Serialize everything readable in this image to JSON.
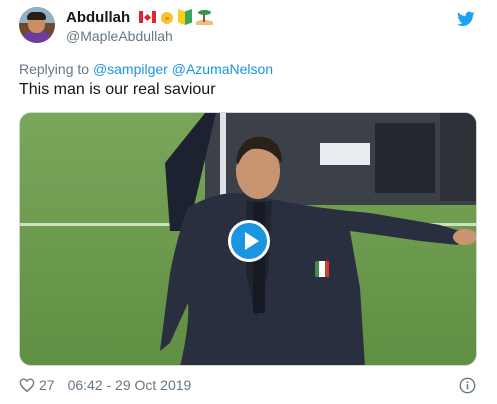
{
  "author": {
    "display_name": "Abdullah",
    "handle": "@MapleAbdullah",
    "name_emojis": [
      "canada-flag-icon",
      "baby-chick-icon",
      "japanese-beginner-symbol-icon",
      "desert-island-icon"
    ]
  },
  "reply": {
    "prefix": "Replying to",
    "mentions": [
      "@sampilger",
      "@AzumaNelson"
    ]
  },
  "tweet": {
    "text": "This man is our real saviour"
  },
  "media": {
    "type": "video",
    "play_icon": "play-icon"
  },
  "footer": {
    "likes": "27",
    "timestamp": "06:42 - 29 Oct 2019",
    "heart_icon": "heart-icon",
    "info_icon": "info-icon"
  },
  "colors": {
    "accent": "#1b95e0",
    "secondary_text": "#657786",
    "primary_text": "#14171a",
    "border": "#ccd6dd"
  }
}
